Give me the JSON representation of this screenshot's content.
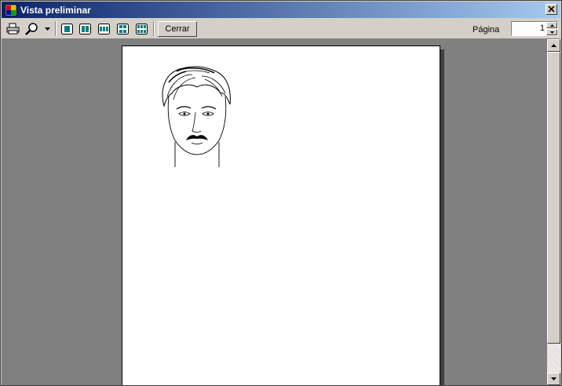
{
  "window": {
    "title": "Vista preliminar"
  },
  "toolbar": {
    "close_label": "Cerrar",
    "page_label": "Página",
    "page_value": "1",
    "icons": [
      "printer-icon",
      "zoom-icon",
      "dropdown-arrow-icon",
      "one-page-icon",
      "two-pages-icon",
      "three-pages-icon",
      "four-pages-icon",
      "six-pages-icon"
    ]
  },
  "preview": {
    "content": "face-sketch"
  }
}
